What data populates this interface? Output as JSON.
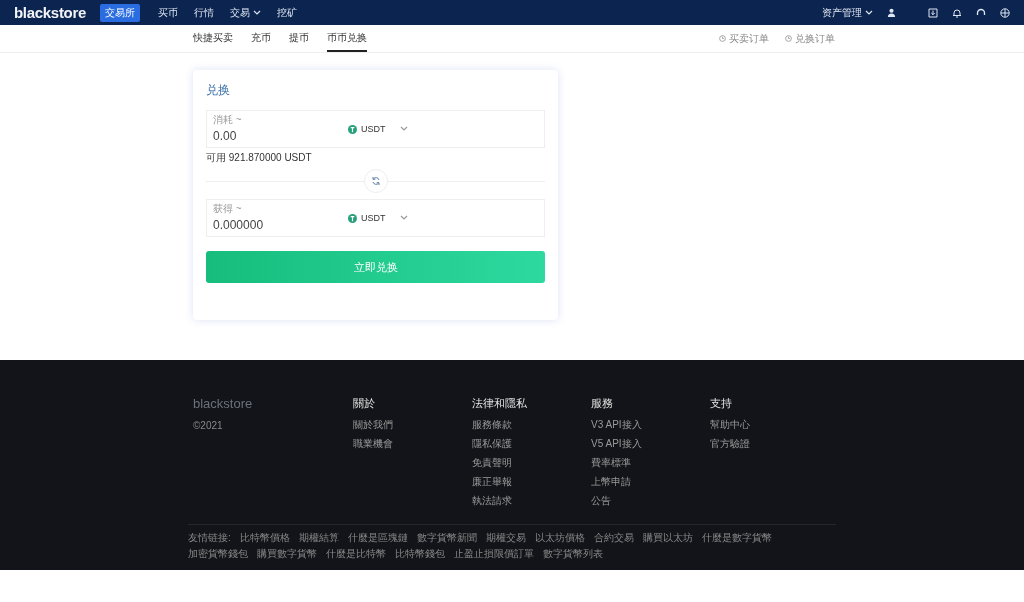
{
  "header": {
    "logo": "blackstore",
    "badge": "交易所",
    "nav": [
      {
        "label": "买币",
        "dropdown": false
      },
      {
        "label": "行情",
        "dropdown": false
      },
      {
        "label": "交易",
        "dropdown": true
      },
      {
        "label": "挖矿",
        "dropdown": false
      }
    ],
    "asset_menu": "资产管理"
  },
  "subnav": {
    "tabs": [
      {
        "label": "快捷买卖",
        "selected": false
      },
      {
        "label": "充币",
        "selected": false
      },
      {
        "label": "提币",
        "selected": false
      },
      {
        "label": "币币兑换",
        "selected": true
      }
    ],
    "links": [
      "买卖订单",
      "兑换订单"
    ]
  },
  "exchange": {
    "title": "兑换",
    "from": {
      "label": "消耗 ~",
      "value": "0.00",
      "coin": "USDT"
    },
    "available": "可用 921.870000 USDT",
    "to": {
      "label": "获得 ~",
      "value": "0.000000",
      "coin": "USDT"
    },
    "submit": "立即兑换"
  },
  "footer": {
    "logo": "blackstore",
    "copyright": "©2021",
    "columns": [
      {
        "title": "關於",
        "links": [
          "關於我們",
          "職業機會"
        ]
      },
      {
        "title": "法律和隱私",
        "links": [
          "服務條款",
          "隱私保護",
          "免責聲明",
          "廉正舉報",
          "執法請求"
        ]
      },
      {
        "title": "服務",
        "links": [
          "V3 API接入",
          "V5 API接入",
          "費率標準",
          "上幣申請",
          "公告"
        ]
      },
      {
        "title": "支持",
        "links": [
          "幫助中心",
          "官方驗證"
        ]
      }
    ],
    "friend_label": "友情链接:",
    "friend_links": [
      "比特幣價格",
      "期權結算",
      "什麼是區塊鏈",
      "數字貨幣新聞",
      "期權交易",
      "以太坊價格",
      "合約交易",
      "購買以太坊",
      "什麼是數字貨幣",
      "加密貨幣錢包",
      "購買數字貨幣",
      "什麼是比特幣",
      "比特幣錢包",
      "止盈止損限價訂單",
      "數字貨幣列表"
    ]
  }
}
